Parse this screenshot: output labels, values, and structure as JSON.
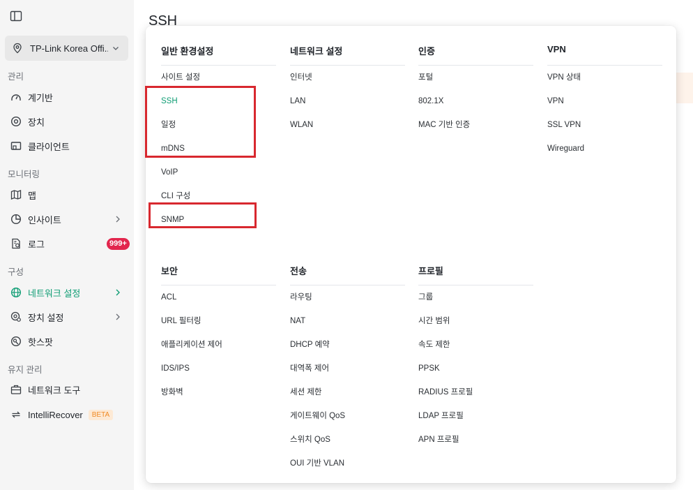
{
  "sidebar": {
    "site_name": "TP-Link Korea Offi...",
    "sections": {
      "manage": "관리",
      "monitor": "모니터링",
      "config": "구성",
      "maintain": "유지 관리"
    },
    "items": {
      "dashboard": "계기반",
      "devices": "장치",
      "clients": "클라이언트",
      "map": "맵",
      "insight": "인사이트",
      "log": "로그",
      "log_badge": "999+",
      "network_settings": "네트워크 설정",
      "device_settings": "장치 설정",
      "hotspot": "핫스팟",
      "network_tools": "네트워크 도구",
      "intellirecover": "IntelliRecover",
      "beta": "BETA"
    }
  },
  "main": {
    "title": "SSH"
  },
  "menu": {
    "general": {
      "title": "일반 환경설정",
      "items": [
        "사이트 설정",
        "SSH",
        "일정",
        "mDNS",
        "VoIP",
        "CLI 구성",
        "SNMP"
      ]
    },
    "network": {
      "title": "네트워크 설정",
      "items": [
        "인터넷",
        "LAN",
        "WLAN"
      ]
    },
    "auth": {
      "title": "인증",
      "items": [
        "포털",
        "802.1X",
        "MAC 기반 인증"
      ]
    },
    "vpn": {
      "title": "VPN",
      "items": [
        "VPN 상태",
        "VPN",
        "SSL VPN",
        "Wireguard"
      ]
    },
    "security": {
      "title": "보안",
      "items": [
        "ACL",
        "URL 필터링",
        "애플리케이션 제어",
        "IDS/IPS",
        "방화벽"
      ]
    },
    "transport": {
      "title": "전송",
      "items": [
        "라우팅",
        "NAT",
        "DHCP 예약",
        "대역폭 제어",
        "세션 제한",
        "게이트웨이 QoS",
        "스위치 QoS",
        "OUI 기반 VLAN"
      ]
    },
    "profile": {
      "title": "프로필",
      "items": [
        "그룹",
        "시간 범위",
        "속도 제한",
        "PPSK",
        "RADIUS 프로필",
        "LDAP 프로필",
        "APN 프로필"
      ]
    }
  },
  "colors": {
    "accent": "#0f9d74",
    "highlight_box": "#d8282f",
    "badge": "#e2264d",
    "beta_text": "#f08a24"
  }
}
